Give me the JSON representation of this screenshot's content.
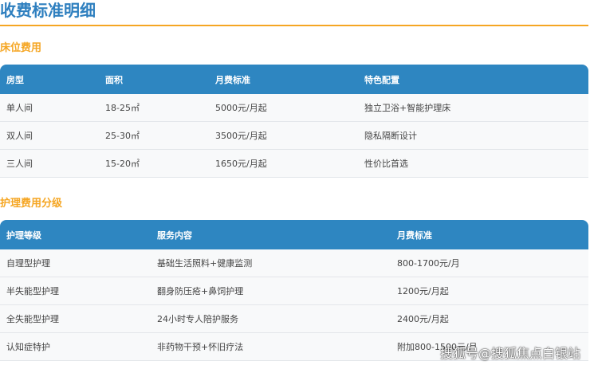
{
  "title": "收费标准明细",
  "bed": {
    "heading": "床位费用",
    "headers": [
      "房型",
      "面积",
      "月费标准",
      "特色配置"
    ],
    "rows": [
      [
        "单人间",
        "18-25㎡",
        "5000元/月起",
        "独立卫浴+智能护理床"
      ],
      [
        "双人间",
        "25-30㎡",
        "3500元/月起",
        "隐私隔断设计"
      ],
      [
        "三人间",
        "15-20㎡",
        "1650元/月起",
        "性价比首选"
      ]
    ]
  },
  "care": {
    "heading": "护理费用分级",
    "headers": [
      "护理等级",
      "服务内容",
      "月费标准"
    ],
    "rows": [
      [
        "自理型护理",
        "基础生活照料+健康监测",
        "800-1700元/月"
      ],
      [
        "半失能型护理",
        "翻身防压疮+鼻饲护理",
        "1200元/月起"
      ],
      [
        "全失能型护理",
        "24小时专人陪护服务",
        "2400元/月起"
      ],
      [
        "认知症特护",
        "非药物干预+怀旧疗法",
        "附加800-1500元/月"
      ]
    ]
  },
  "watermark": "搜狐号@搜狐焦点白银站"
}
